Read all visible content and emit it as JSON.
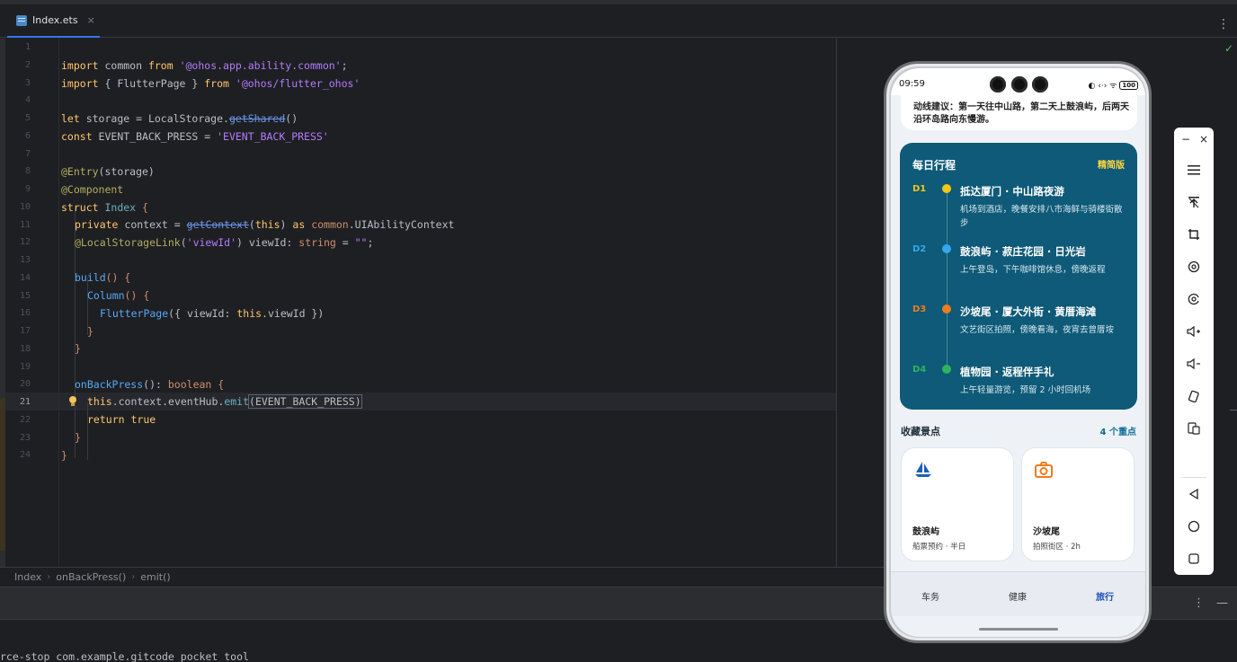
{
  "editor": {
    "tab_label": "Index.ets",
    "tab_close": "×",
    "more": "⋮",
    "check": "✓",
    "line_numbers": [
      "1",
      "2",
      "3",
      "4",
      "5",
      "6",
      "7",
      "8",
      "9",
      "10",
      "11",
      "12",
      "13",
      "14",
      "15",
      "16",
      "17",
      "18",
      "19",
      "20",
      "21",
      "22",
      "23",
      "24"
    ],
    "current_line": "21"
  },
  "code_lines": {
    "l2": [
      "import",
      " common ",
      "from",
      " ",
      "'@ohos.app.ability.common'",
      ";"
    ],
    "l3": [
      "import",
      " { FlutterPage } ",
      "from",
      " ",
      "'@ohos/flutter_ohos'"
    ],
    "l5": [
      "let",
      " storage = LocalStorage.",
      "getShared",
      "()"
    ],
    "l6": [
      "const",
      " EVENT_BACK_PRESS = ",
      "'EVENT_BACK_PRESS'"
    ],
    "l8": [
      "@Entry",
      "(storage)"
    ],
    "l9": [
      "@Component"
    ],
    "l10": [
      "struct",
      " ",
      "Index",
      " {"
    ],
    "l11": [
      "private",
      " context = ",
      "getContext",
      "(",
      "this",
      ") ",
      "as",
      " ",
      "common",
      ".UIAbilityContext"
    ],
    "l12": [
      "@LocalStorageLink",
      "(",
      "'viewId'",
      ") viewId: ",
      "string",
      " = ",
      "\"\"",
      ";"
    ],
    "l14": [
      "build",
      "() {"
    ],
    "l15": [
      "Column",
      "() {"
    ],
    "l16": [
      "FlutterPage",
      "({ viewId: ",
      "this",
      ".viewId })"
    ],
    "l17": [
      "}"
    ],
    "l18": [
      "}"
    ],
    "l20": [
      "onBackPress",
      "(): ",
      "boolean",
      " {"
    ],
    "l21": [
      "this",
      ".context.eventHub.",
      "emit",
      "(EVENT_BACK_PRESS)"
    ],
    "l22": [
      "return",
      " ",
      "true"
    ],
    "l23": [
      "}"
    ],
    "l24": [
      "}"
    ]
  },
  "breadcrumb": {
    "items": [
      "Index",
      "onBackPress()",
      "emit()"
    ],
    "separator": "›"
  },
  "bottom_tools": {
    "more": "⋮",
    "minimize": "—"
  },
  "terminal": {
    "text": "rce-stop com.example.gitcode_pocket_tool"
  },
  "phone": {
    "status": {
      "time": "09:59",
      "signal": "◐ ‹·› ᯤ",
      "battery": "100"
    },
    "top_card": {
      "text": "动线建议：第一天往中山路，第二天上鼓浪屿，后两天沿环岛路向东慢游。"
    },
    "itinerary": {
      "title": "每日行程",
      "badge": "精简版",
      "days": [
        {
          "code": "D1",
          "title": "抵达厦门 · 中山路夜游",
          "desc": "机场到酒店，晚餐安排八市海鲜与骑楼街散步",
          "color": "#f5c518"
        },
        {
          "code": "D2",
          "title": "鼓浪屿 · 菽庄花园 · 日光岩",
          "desc": "上午登岛，下午咖啡馆休息，傍晚返程",
          "color": "#35a7f0"
        },
        {
          "code": "D3",
          "title": "沙坡尾 · 厦大外街 · 黄厝海滩",
          "desc": "文艺街区拍照，傍晚看海，夜宵去曾厝垵",
          "color": "#f07b1e"
        },
        {
          "code": "D4",
          "title": "植物园 · 返程伴手礼",
          "desc": "上午轻量游览，预留 2 小时回机场",
          "color": "#2fb35a"
        }
      ]
    },
    "favorites": {
      "title": "收藏景点",
      "count": "4 个重点",
      "cards": [
        {
          "name": "鼓浪屿",
          "meta": "船票预约 · 半日",
          "icon": "sailboat-icon",
          "color": "#1e5fb8"
        },
        {
          "name": "沙坡尾",
          "meta": "拍照街区 · 2h",
          "icon": "camera-icon",
          "color": "#f07b1e"
        }
      ]
    },
    "tabs": [
      "车务",
      "健康",
      "旅行"
    ],
    "active_tab": "旅行"
  },
  "emulator_toolbar": {
    "minimize": "−",
    "close": "×",
    "buttons": [
      "menu-icon",
      "pin-top-icon",
      "crop-icon",
      "rotate-icon",
      "screenshot-icon",
      "volume-up-icon",
      "volume-down-icon",
      "rotate-device-icon",
      "multi-device-icon",
      "back-icon",
      "home-icon",
      "recents-icon"
    ]
  },
  "colors": {
    "accent": "#3574f0",
    "itinerary_bg": "#0e5a78",
    "badge": "#ffd740",
    "active_tab": "#1e50b8"
  }
}
